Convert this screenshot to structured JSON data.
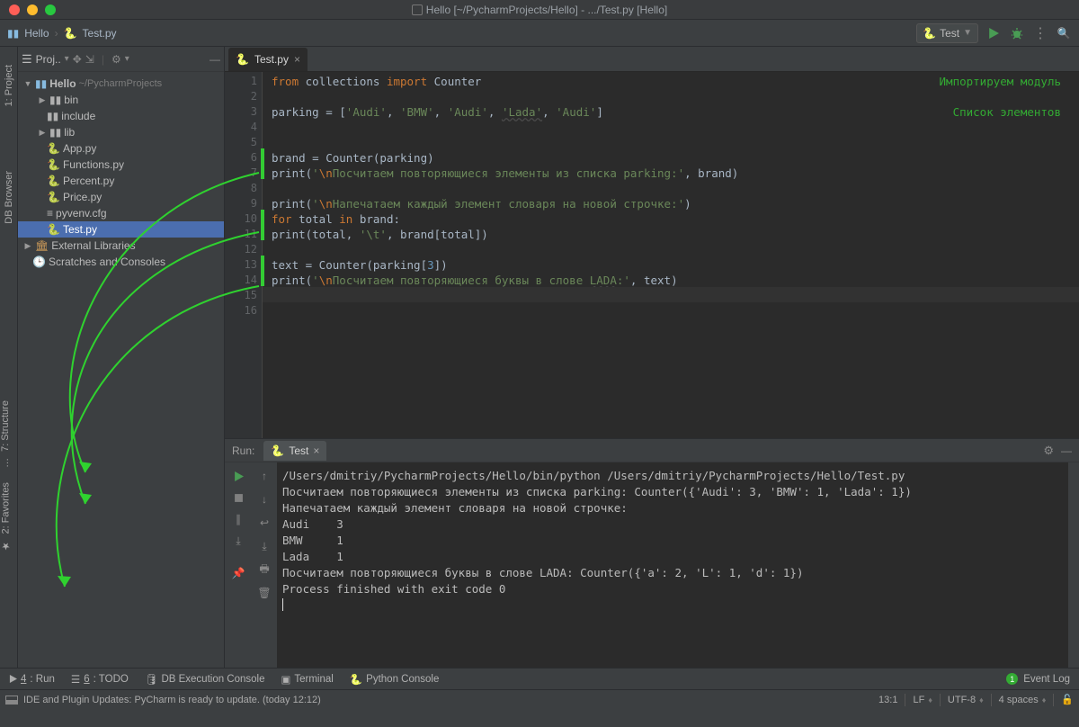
{
  "window": {
    "title": "Hello [~/PycharmProjects/Hello] - .../Test.py [Hello]"
  },
  "breadcrumb": {
    "root": "Hello",
    "file": "Test.py"
  },
  "run_config": {
    "label": "Test"
  },
  "left_rail": {
    "project": "1: Project",
    "dbbrowser": "DB Browser",
    "structure": "7: Structure",
    "favorites": "2: Favorites"
  },
  "project_panel": {
    "title": "Proj..",
    "tree": {
      "root": "Hello",
      "root_path": "~/PycharmProjects",
      "items": [
        {
          "name": "bin",
          "kind": "folder",
          "expandable": true
        },
        {
          "name": "include",
          "kind": "folder",
          "expandable": false
        },
        {
          "name": "lib",
          "kind": "folder",
          "expandable": true
        },
        {
          "name": "App.py",
          "kind": "py"
        },
        {
          "name": "Functions.py",
          "kind": "py"
        },
        {
          "name": "Percent.py",
          "kind": "py"
        },
        {
          "name": "Price.py",
          "kind": "py"
        },
        {
          "name": "pyvenv.cfg",
          "kind": "cfg"
        },
        {
          "name": "Test.py",
          "kind": "py",
          "selected": true
        }
      ],
      "extlib": "External Libraries",
      "scratch": "Scratches and Consoles"
    }
  },
  "editor": {
    "tab": "Test.py",
    "lines": [
      "1",
      "2",
      "3",
      "4",
      "5",
      "6",
      "7",
      "8",
      "9",
      "10",
      "11",
      "12",
      "13",
      "14",
      "15",
      "16"
    ],
    "cmt1": "Импортируем модуль",
    "cmt2": "Список элементов",
    "l1a": "from ",
    "l1b": "collections ",
    "l1c": "import ",
    "l1d": "Counter",
    "l3a": "parking = [",
    "l3b": "'Audi'",
    "l3c": ", ",
    "l3d": "'BMW'",
    "l3e": ", ",
    "l3f": "'Audi'",
    "l3g": ", ",
    "l3h": "'Lada'",
    "l3i": ", ",
    "l3j": "'Audi'",
    "l3k": "]",
    "l6a": "brand = Counter(parking)",
    "l7a": "print",
    "l7b": "(",
    "l7c": "'",
    "l7d": "\\n",
    "l7e": "Посчитаем повторяющиеся элементы из списка parking:'",
    "l7f": ", brand)",
    "l9a": "print",
    "l9b": "(",
    "l9c": "'",
    "l9d": "\\n",
    "l9e": "Напечатаем каждый элемент словаря на новой строчке:'",
    "l9f": ")",
    "l10a": "for ",
    "l10b": "total ",
    "l10c": "in ",
    "l10d": "brand:",
    "l11a": "    print(total, ",
    "l11b": "'\\t'",
    "l11c": ", brand[total])",
    "l13a": "text = Counter(parking[",
    "l13b": "3",
    "l13c": "])",
    "l14a": "print",
    "l14b": "(",
    "l14c": "'",
    "l14d": "\\n",
    "l14e": "Посчитаем повторяющиеся буквы в слове ",
    "l14f": "LADA",
    "l14g": ":'",
    "l14h": ", text)"
  },
  "run": {
    "title": "Run:",
    "tab": "Test",
    "output": [
      "/Users/dmitriy/PycharmProjects/Hello/bin/python /Users/dmitriy/PycharmProjects/Hello/Test.py",
      "",
      "Посчитаем повторяющиеся элементы из списка parking: Counter({'Audi': 3, 'BMW': 1, 'Lada': 1})",
      "",
      "Напечатаем каждый элемент словаря на новой строчке:",
      "Audi    3",
      "BMW     1",
      "Lada    1",
      "",
      "Посчитаем повторяющиеся буквы в слове LADA: Counter({'a': 2, 'L': 1, 'd': 1})",
      "",
      "Process finished with exit code 0"
    ]
  },
  "bottom": {
    "run": {
      "pre": "4",
      "label": ": Run"
    },
    "todo": {
      "pre": "6",
      "label": ": TODO"
    },
    "dbexec": "DB Execution Console",
    "terminal": "Terminal",
    "pyconsole": "Python Console",
    "eventlog": "Event Log",
    "events": "1"
  },
  "status": {
    "msg": "IDE and Plugin Updates: PyCharm is ready to update. (today 12:12)",
    "line": "13:1",
    "eol": "LF",
    "enc": "UTF-8",
    "indent": "4 spaces"
  }
}
